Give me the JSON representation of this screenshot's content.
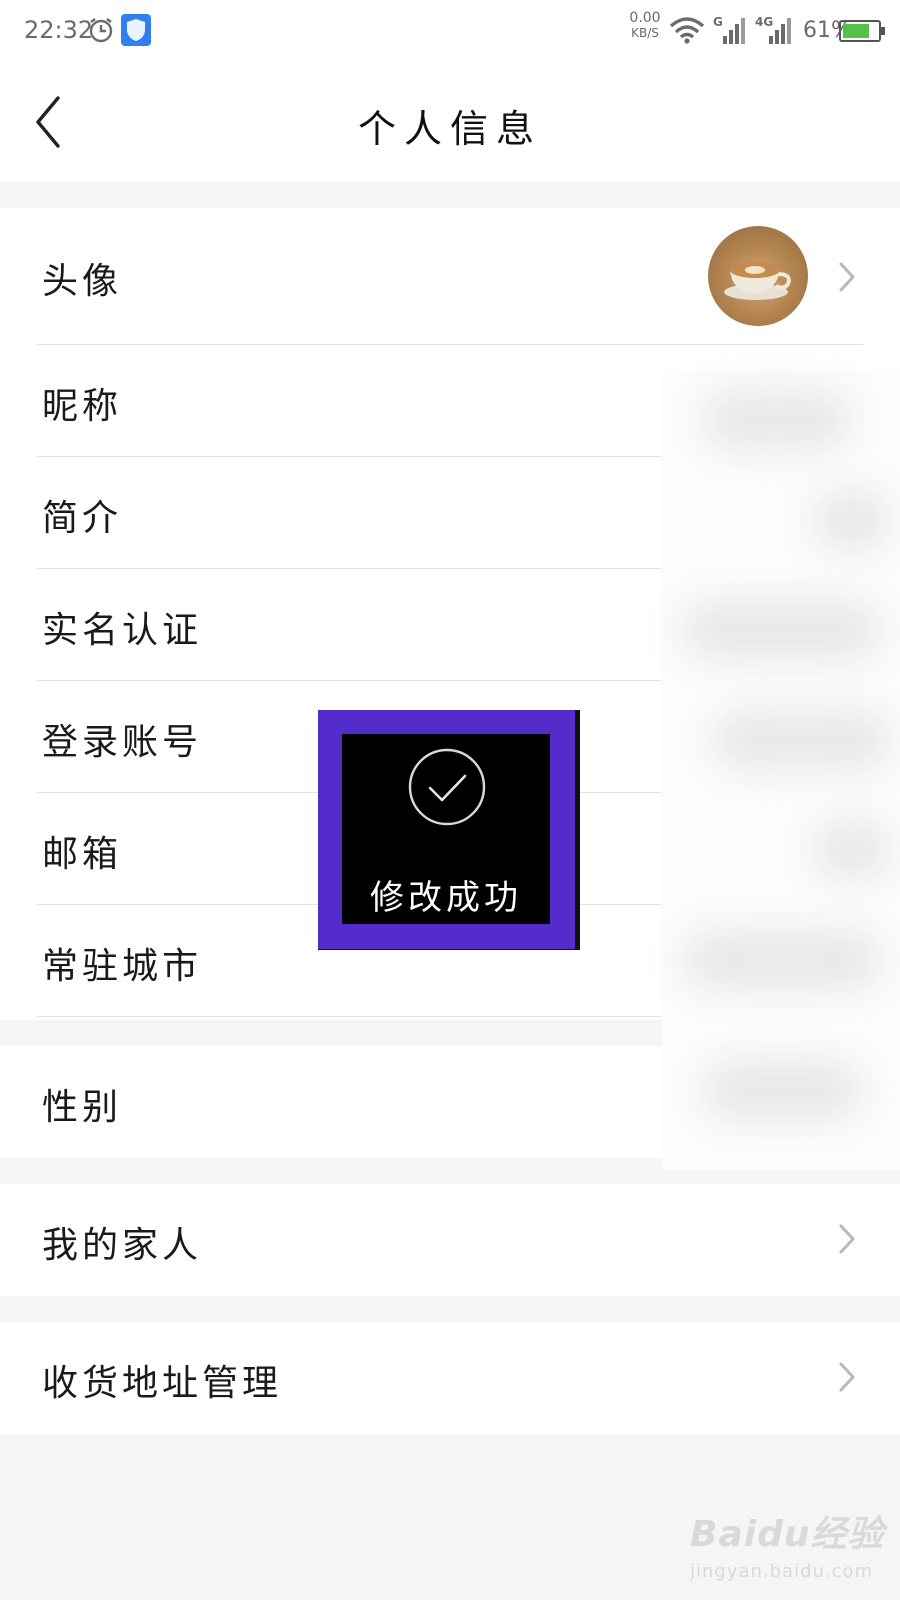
{
  "status_bar": {
    "time": "22:32",
    "net_speed_value": "0.00",
    "net_speed_unit": "KB/S",
    "g_label": "G",
    "fourg_label": "4G",
    "battery": "61%"
  },
  "header": {
    "title": "个人信息"
  },
  "rows": {
    "avatar": "头像",
    "nickname": "昵称",
    "intro": "简介",
    "real_name": "实名认证",
    "login_account": "登录账号",
    "email": "邮箱",
    "city": "常驻城市",
    "gender": "性别",
    "family": "我的家人",
    "address": "收货地址管理"
  },
  "toast": {
    "message": "修改成功"
  },
  "watermark": {
    "brand": "Baidu经验",
    "url": "jingyan.baidu.com"
  },
  "colors": {
    "toast_frame": "#552ccc",
    "toast_bg": "#000000",
    "battery_fill": "#54c24a",
    "page_bg": "#f4f5f7"
  }
}
